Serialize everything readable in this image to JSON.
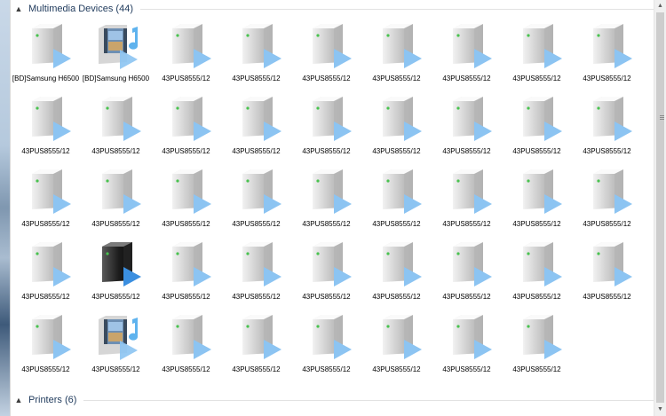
{
  "groups": [
    {
      "title": "Multimedia Devices (44)",
      "chevron": "▲",
      "expanded": true
    },
    {
      "title": "Printers (6)",
      "chevron": "▲",
      "expanded": true
    }
  ],
  "devices": [
    {
      "label": "[BD]Samsung H6500",
      "icon": "media-server-icon"
    },
    {
      "label": "[BD]Samsung H6500",
      "icon": "media-video-music-icon"
    },
    {
      "label": "43PUS8555/12",
      "icon": "media-server-icon"
    },
    {
      "label": "43PUS8555/12",
      "icon": "media-server-icon"
    },
    {
      "label": "43PUS8555/12",
      "icon": "media-server-icon"
    },
    {
      "label": "43PUS8555/12",
      "icon": "media-server-icon"
    },
    {
      "label": "43PUS8555/12",
      "icon": "media-server-icon"
    },
    {
      "label": "43PUS8555/12",
      "icon": "media-server-icon"
    },
    {
      "label": "43PUS8555/12",
      "icon": "media-server-icon"
    },
    {
      "label": "43PUS8555/12",
      "icon": "media-server-icon"
    },
    {
      "label": "43PUS8555/12",
      "icon": "media-server-icon"
    },
    {
      "label": "43PUS8555/12",
      "icon": "media-server-icon"
    },
    {
      "label": "43PUS8555/12",
      "icon": "media-server-icon"
    },
    {
      "label": "43PUS8555/12",
      "icon": "media-server-icon"
    },
    {
      "label": "43PUS8555/12",
      "icon": "media-server-icon"
    },
    {
      "label": "43PUS8555/12",
      "icon": "media-server-icon"
    },
    {
      "label": "43PUS8555/12",
      "icon": "media-server-icon"
    },
    {
      "label": "43PUS8555/12",
      "icon": "media-server-icon"
    },
    {
      "label": "43PUS8555/12",
      "icon": "media-server-icon"
    },
    {
      "label": "43PUS8555/12",
      "icon": "media-server-icon"
    },
    {
      "label": "43PUS8555/12",
      "icon": "media-server-icon"
    },
    {
      "label": "43PUS8555/12",
      "icon": "media-server-icon"
    },
    {
      "label": "43PUS8555/12",
      "icon": "media-server-icon"
    },
    {
      "label": "43PUS8555/12",
      "icon": "media-server-icon"
    },
    {
      "label": "43PUS8555/12",
      "icon": "media-server-icon"
    },
    {
      "label": "43PUS8555/12",
      "icon": "media-server-icon"
    },
    {
      "label": "43PUS8555/12",
      "icon": "media-server-icon"
    },
    {
      "label": "43PUS8555/12",
      "icon": "media-server-icon"
    },
    {
      "label": "43PUS8555/12",
      "icon": "media-server-dark-icon"
    },
    {
      "label": "43PUS8555/12",
      "icon": "media-server-icon"
    },
    {
      "label": "43PUS8555/12",
      "icon": "media-server-icon"
    },
    {
      "label": "43PUS8555/12",
      "icon": "media-server-icon"
    },
    {
      "label": "43PUS8555/12",
      "icon": "media-server-icon"
    },
    {
      "label": "43PUS8555/12",
      "icon": "media-server-icon"
    },
    {
      "label": "43PUS8555/12",
      "icon": "media-server-icon"
    },
    {
      "label": "43PUS8555/12",
      "icon": "media-server-icon"
    },
    {
      "label": "43PUS8555/12",
      "icon": "media-server-icon"
    },
    {
      "label": "43PUS8555/12",
      "icon": "media-video-music-icon"
    },
    {
      "label": "43PUS8555/12",
      "icon": "media-server-icon"
    },
    {
      "label": "43PUS8555/12",
      "icon": "media-server-icon"
    },
    {
      "label": "43PUS8555/12",
      "icon": "media-server-icon"
    },
    {
      "label": "43PUS8555/12",
      "icon": "media-server-icon"
    },
    {
      "label": "43PUS8555/12",
      "icon": "media-server-icon"
    },
    {
      "label": "43PUS8555/12",
      "icon": "media-server-icon"
    }
  ],
  "colors": {
    "header_text": "#1e395b",
    "play_arrow": "#8cc4f2",
    "play_arrow_dark": "#3b8fe0",
    "status_led": "#49c24f"
  }
}
